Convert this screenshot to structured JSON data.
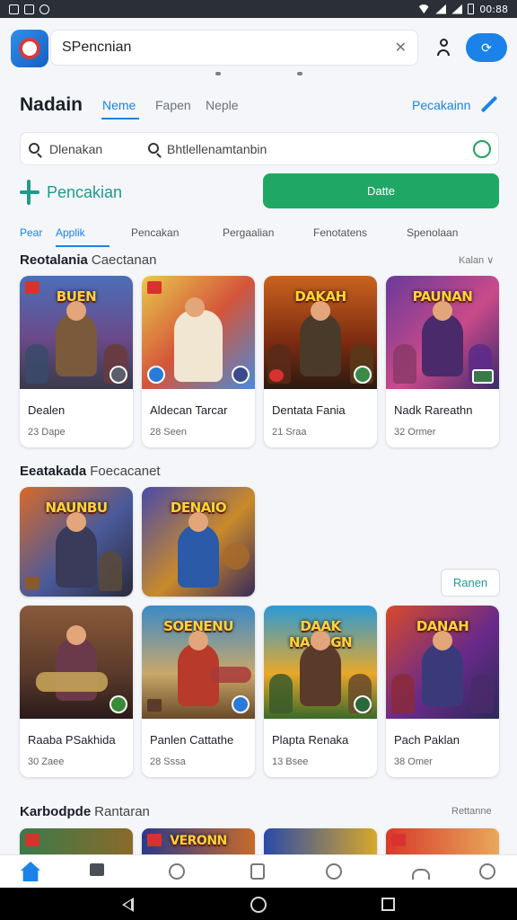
{
  "status_bar": {
    "time": "00:88"
  },
  "top_search": {
    "value": "SPencnian",
    "clear": "✕"
  },
  "header": {
    "title": "Nadain",
    "tabs": [
      "Neme",
      "Fapen",
      "Neple"
    ],
    "link": "Pecakainn"
  },
  "search": {
    "left_text": "Dlenakan",
    "right_text": "Bhtlellenamtanbin"
  },
  "action": {
    "brand": "Pencakian",
    "button": "Datte"
  },
  "categories": [
    "Pear",
    "Applik",
    "Pencakan",
    "Pergaalian",
    "Fenotatens",
    "Spenolaan"
  ],
  "sections": [
    {
      "title": "Reotalania",
      "subtitle": "Caectanan",
      "more": "Kalan ∨"
    },
    {
      "title": "Eeatakada",
      "subtitle": "Foecacanet",
      "button": "Ranen"
    },
    {
      "title": "Karbodpde",
      "subtitle": "Rantaran",
      "more": "Rettanne"
    }
  ],
  "row1": [
    {
      "art": "BUEN",
      "name": "Dealen",
      "meta": "23 Dape"
    },
    {
      "art": "",
      "name": "Aldecan Tarcar",
      "meta": "28 Seen"
    },
    {
      "art": "DAKAH",
      "name": "Dentata Fania",
      "meta": "21 Sraa"
    },
    {
      "art": "PAUNAN",
      "name": "Nadk Rareathn",
      "meta": "32 Ormer"
    }
  ],
  "row2": [
    {
      "art": "NAUNBU"
    },
    {
      "art": "DENAIO"
    }
  ],
  "row3": [
    {
      "art": "",
      "name": "Raaba PSakhida",
      "meta": "30 Zaee"
    },
    {
      "art": "SOENENU",
      "name": "Panlen Cattathe",
      "meta": "28 Sssa"
    },
    {
      "art": "DAAK NANAGN",
      "name": "Plapta Renaka",
      "meta": "13 Bsee"
    },
    {
      "art": "DANAH",
      "name": "Pach Paklan",
      "meta": "38 Omer"
    }
  ],
  "row4": [
    {
      "art": ""
    },
    {
      "art": "VERONN"
    },
    {
      "art": ""
    },
    {
      "art": ""
    }
  ],
  "colors": {
    "accent": "#1a82e8",
    "green": "#1fa865",
    "teal": "#1f9a8d"
  }
}
